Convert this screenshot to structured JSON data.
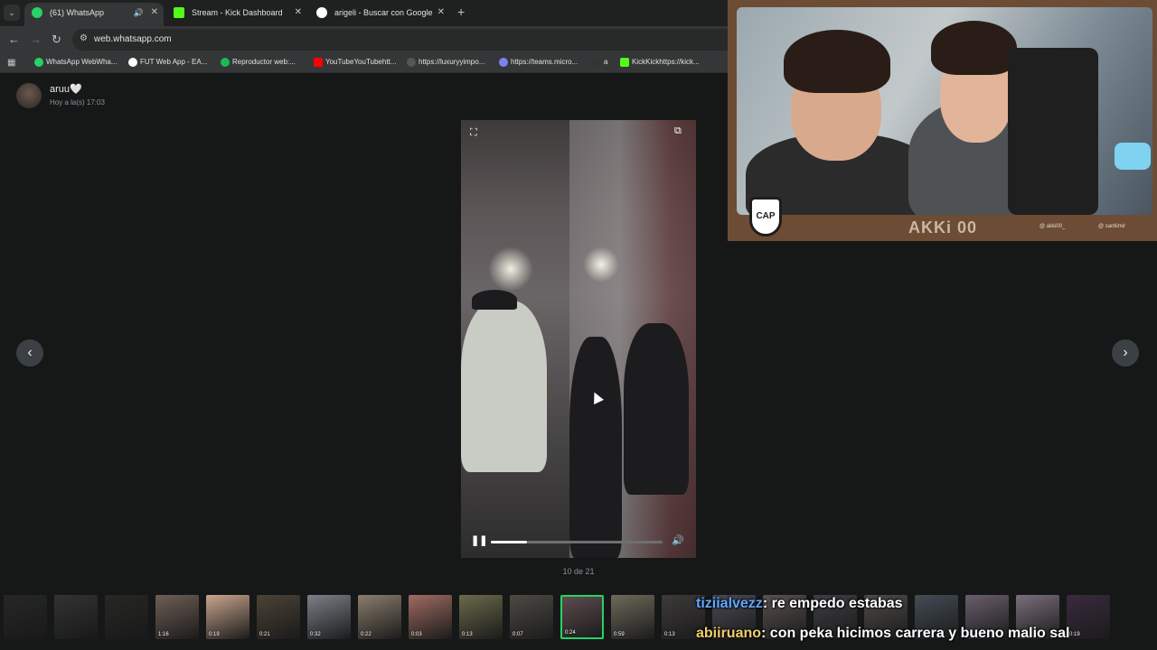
{
  "browser": {
    "tabs": [
      {
        "label": "(61) WhatsApp",
        "active": true,
        "icon": "whatsapp-icon",
        "color": "#25d366"
      },
      {
        "label": "Stream - Kick Dashboard",
        "active": false,
        "icon": "kick-icon",
        "color": "#53fc18"
      },
      {
        "label": "arigeli - Buscar con Google",
        "active": false,
        "icon": "google-icon",
        "color": "#ffffff"
      }
    ],
    "url": "web.whatsapp.com",
    "bookmarks": [
      {
        "label": "WhatsApp WebWha...",
        "color": "#25d366"
      },
      {
        "label": "FUT Web App - EA...",
        "color": "#ffffff"
      },
      {
        "label": "Reproductor web:...",
        "color": "#1db954"
      },
      {
        "label": "YouTubeYouTubehtt...",
        "color": "#ff0000"
      },
      {
        "label": "https://luxuryyimpo...",
        "color": "#222222"
      },
      {
        "label": "https://teams.micro...",
        "color": "#7b83eb"
      },
      {
        "label": "a",
        "color": "#333333"
      },
      {
        "label": "KickKickhttps://kick...",
        "color": "#53fc18"
      }
    ]
  },
  "viewer": {
    "sender_name": "aruu🤍",
    "sender_time": "Hoy a la(s) 17:03",
    "counter": "10 de 21",
    "video_progress": 0.21
  },
  "thumbnails": [
    {
      "duration": "",
      "dim": true,
      "color": "#3a3a3a"
    },
    {
      "duration": "",
      "dim": true,
      "color": "#555555"
    },
    {
      "duration": "",
      "dim": true,
      "color": "#3f3a36"
    },
    {
      "duration": "1:16",
      "dim": false,
      "color": "#6e5f55"
    },
    {
      "duration": "0:19",
      "dim": false,
      "color": "#c9a58e"
    },
    {
      "duration": "0:21",
      "dim": false,
      "color": "#4b4335"
    },
    {
      "duration": "0:32",
      "dim": false,
      "color": "#7b8088"
    },
    {
      "duration": "0:22",
      "dim": false,
      "color": "#8a7d6d"
    },
    {
      "duration": "0:03",
      "dim": false,
      "color": "#a06b60"
    },
    {
      "duration": "0:13",
      "dim": false,
      "color": "#6b6a4a"
    },
    {
      "duration": "0:07",
      "dim": false,
      "color": "#4d4a44"
    },
    {
      "duration": "0:24",
      "dim": false,
      "color": "#5e4b4f",
      "selected": true
    },
    {
      "duration": "0:59",
      "dim": false,
      "color": "#6e6a5a"
    },
    {
      "duration": "0:13",
      "dim": false,
      "color": "#3e3a3a"
    },
    {
      "duration": "",
      "dim": false,
      "color": "#4a4a55"
    },
    {
      "duration": "",
      "dim": false,
      "color": "#5a5050"
    },
    {
      "duration": "",
      "dim": false,
      "color": "#3f3f46"
    },
    {
      "duration": "",
      "dim": false,
      "color": "#504a4a"
    },
    {
      "duration": "",
      "dim": false,
      "color": "#444c55"
    },
    {
      "duration": "",
      "dim": false,
      "color": "#6a5e6e"
    },
    {
      "duration": "",
      "dim": false,
      "color": "#7b6e7e"
    },
    {
      "duration": "0:19",
      "dim": false,
      "color": "#3a2a3e"
    }
  ],
  "webcam": {
    "badge": "CAP",
    "name": "AKKi 00",
    "social_left": "@ akki00_",
    "social_right": "@ santiimir"
  },
  "chat": [
    {
      "user": "tiziialvezz",
      "message": ": re empedo estabas"
    },
    {
      "user": "abiiruano",
      "message": ": con peka hicimos carrera y bueno malio sal"
    }
  ]
}
